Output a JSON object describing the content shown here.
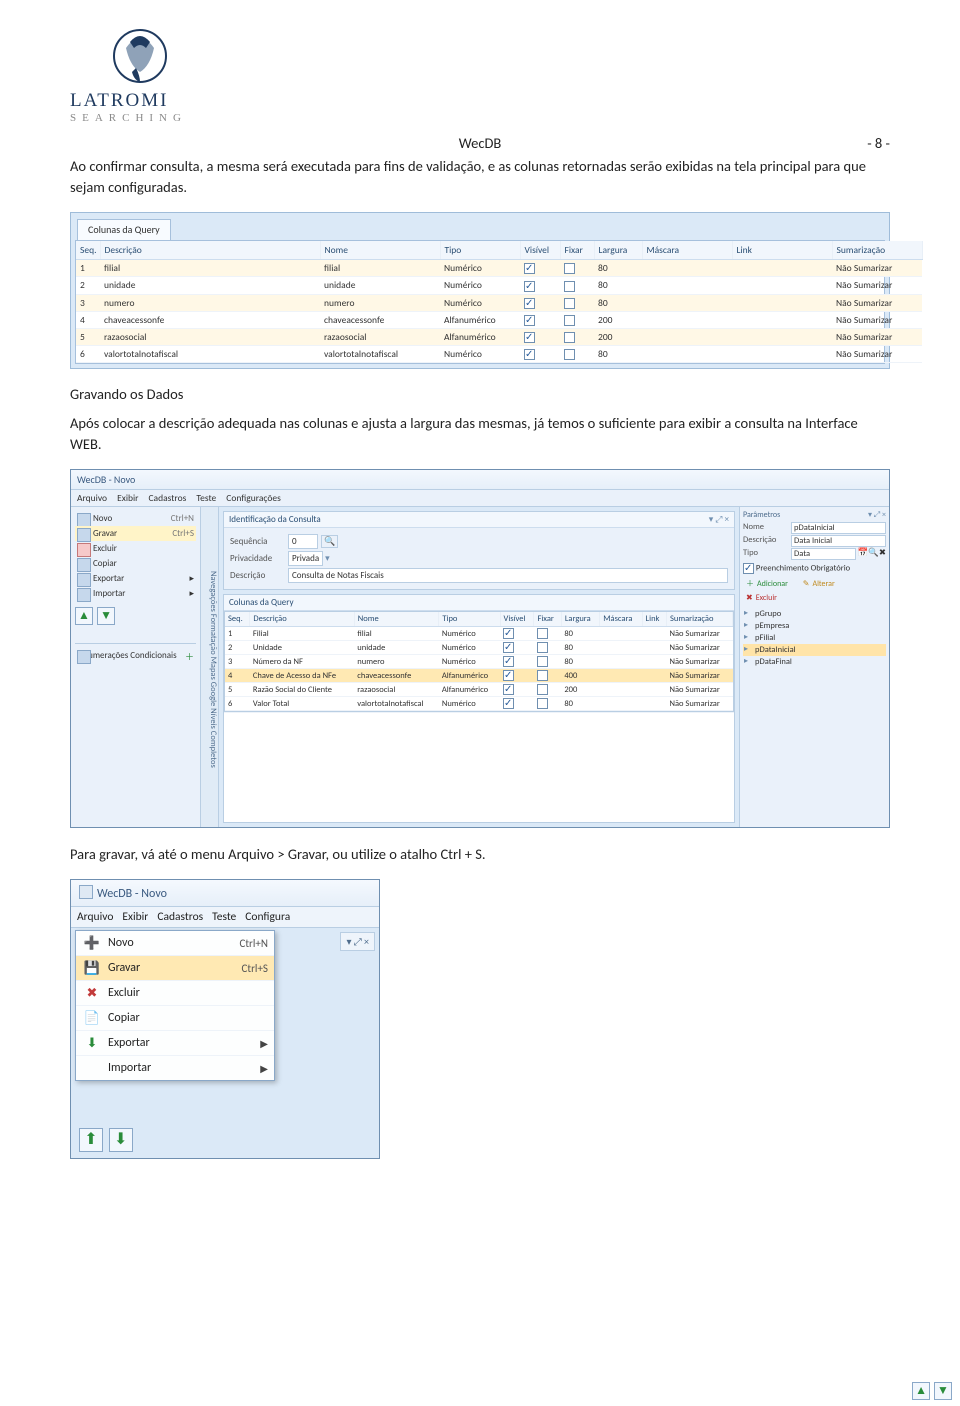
{
  "header": {
    "title": "WecDB",
    "page": "- 8 -"
  },
  "logo": {
    "name": "LATROMI",
    "tagline": "S E A R C H I N G"
  },
  "para1": "Ao confirmar consulta, a mesma será executada para fins de validação, e as colunas retornadas serão exibidas na tela principal para que sejam configuradas.",
  "heading1": "Gravando os Dados",
  "para2": "Após colocar a descrição adequada nas colunas e ajusta a largura das mesmas, já temos o suficiente para exibir a consulta na Interface WEB.",
  "para3": "Para gravar, vá até o menu Arquivo > Gravar, ou utilize o atalho Ctrl + S.",
  "shot1": {
    "tab": "Colunas da Query",
    "cols": [
      "Seq.",
      "Descrição",
      "Nome",
      "Tipo",
      "Visível",
      "Fixar",
      "Largura",
      "Máscara",
      "Link",
      "Sumarização"
    ],
    "rows": [
      {
        "seq": "1",
        "desc": "filial",
        "nome": "filial",
        "tipo": "Numérico",
        "vis": true,
        "fix": false,
        "larg": "80",
        "sum": "Não Sumarizar",
        "alt": true
      },
      {
        "seq": "2",
        "desc": "unidade",
        "nome": "unidade",
        "tipo": "Numérico",
        "vis": true,
        "fix": false,
        "larg": "80",
        "sum": "Não Sumarizar"
      },
      {
        "seq": "3",
        "desc": "numero",
        "nome": "numero",
        "tipo": "Numérico",
        "vis": true,
        "fix": false,
        "larg": "80",
        "sum": "Não Sumarizar",
        "alt": true
      },
      {
        "seq": "4",
        "desc": "chaveacessonfe",
        "nome": "chaveacessonfe",
        "tipo": "Alfanumérico",
        "vis": true,
        "fix": false,
        "larg": "200",
        "sum": "Não Sumarizar"
      },
      {
        "seq": "5",
        "desc": "razaosocial",
        "nome": "razaosocial",
        "tipo": "Alfanumérico",
        "vis": true,
        "fix": false,
        "larg": "200",
        "sum": "Não Sumarizar",
        "alt": true
      },
      {
        "seq": "6",
        "desc": "valortotalnotafiscal",
        "nome": "valortotalnotafiscal",
        "tipo": "Numérico",
        "vis": true,
        "fix": false,
        "larg": "80",
        "sum": "Não Sumarizar"
      }
    ]
  },
  "shot2": {
    "title": "WecDB - Novo",
    "menu": [
      "Arquivo",
      "Exibir",
      "Cadastros",
      "Teste",
      "Configurações"
    ],
    "left": {
      "items": [
        {
          "label": "Novo",
          "shortcut": "Ctrl+N"
        },
        {
          "label": "Gravar",
          "shortcut": "Ctrl+S",
          "hl": true
        },
        {
          "label": "Excluir",
          "x": true
        },
        {
          "label": "Copiar"
        },
        {
          "label": "Exportar",
          "arrow": true
        },
        {
          "label": "Importar",
          "arrow": true
        }
      ],
      "bottomTabs": [
        "Navegações",
        "Formatação",
        "Mapas Google",
        "Níveis Completos"
      ]
    },
    "centerId": {
      "title": "Identificação da Consulta",
      "seqLabel": "Sequência",
      "seqVal": "0",
      "privLabel": "Privacidade",
      "privVal": "Privada",
      "descLabel": "Descrição",
      "descVal": "Consulta de Notas Fiscais"
    },
    "centerGrid": {
      "title": "Colunas da Query",
      "cols": [
        "Seq.",
        "Descrição",
        "Nome",
        "Tipo",
        "Visível",
        "Fixar",
        "Largura",
        "Máscara",
        "Link",
        "Sumarização"
      ],
      "rows": [
        {
          "seq": "1",
          "desc": "Filial",
          "nome": "filial",
          "tipo": "Numérico",
          "vis": true,
          "fix": false,
          "larg": "80",
          "sum": "Não Sumarizar"
        },
        {
          "seq": "2",
          "desc": "Unidade",
          "nome": "unidade",
          "tipo": "Numérico",
          "vis": true,
          "fix": false,
          "larg": "80",
          "sum": "Não Sumarizar"
        },
        {
          "seq": "3",
          "desc": "Número da NF",
          "nome": "numero",
          "tipo": "Numérico",
          "vis": true,
          "fix": false,
          "larg": "80",
          "sum": "Não Sumarizar"
        },
        {
          "seq": "4",
          "desc": "Chave de Acesso da NFe",
          "nome": "chaveacessonfe",
          "tipo": "Alfanumérico",
          "vis": true,
          "fix": false,
          "larg": "400",
          "sum": "Não Sumarizar",
          "hl": true
        },
        {
          "seq": "5",
          "desc": "Razão Social do Cliente",
          "nome": "razaosocial",
          "tipo": "Alfanumérico",
          "vis": true,
          "fix": false,
          "larg": "200",
          "sum": "Não Sumarizar"
        },
        {
          "seq": "6",
          "desc": "Valor Total",
          "nome": "valortotalnotafiscal",
          "tipo": "Numérico",
          "vis": true,
          "fix": false,
          "larg": "80",
          "sum": "Não Sumarizar"
        }
      ]
    },
    "right": {
      "title": "Parâmetros",
      "nomeLabel": "Nome",
      "nomeVal": "pDataInicial",
      "descLabel": "Descrição",
      "descVal": "Data Inicial",
      "tipoLabel": "Tipo",
      "tipoVal": "Data",
      "req": "Preenchimento Obrigatório",
      "addBtn": "Adicionar",
      "altBtn": "Alterar",
      "delBtn": "Excluir",
      "tree": [
        "pGrupo",
        "pEmpresa",
        "pFilial",
        "pDataInicial",
        "pDataFinal"
      ],
      "selected": "pDataInicial"
    }
  },
  "shot3": {
    "title": "WecDB - Novo",
    "menu": [
      "Arquivo",
      "Exibir",
      "Cadastros",
      "Teste",
      "Configura"
    ],
    "toolbarFrag": "▾  ⤢  ×",
    "items": [
      {
        "icon": "➕",
        "label": "Novo",
        "shortcut": "Ctrl+N",
        "color": "#2a8c3a"
      },
      {
        "icon": "💾",
        "label": "Gravar",
        "shortcut": "Ctrl+S",
        "hl": true,
        "color": "#6b7e96"
      },
      {
        "icon": "✖",
        "label": "Excluir",
        "color": "#c23b3b"
      },
      {
        "icon": "📄",
        "label": "Copiar",
        "color": "#6fa0d4"
      },
      {
        "icon": "⬇",
        "label": "Exportar",
        "arrow": true,
        "color": "#2a8c3a"
      },
      {
        "icon": "",
        "label": "Importar",
        "arrow": true
      }
    ]
  }
}
